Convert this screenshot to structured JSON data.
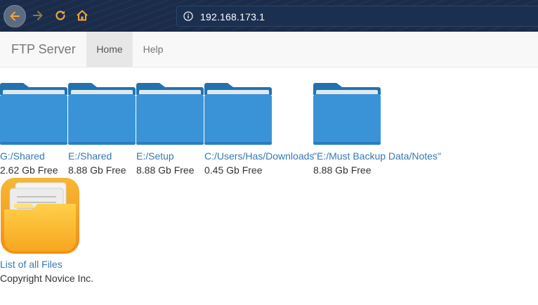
{
  "browser": {
    "url": "192.168.173.1",
    "icons": [
      "back-arrow-icon",
      "forward-arrow-icon",
      "reload-icon",
      "home-icon",
      "info-icon"
    ],
    "colors": {
      "toolbar": "#1a2c4a",
      "home_icon": "#f0a63a",
      "reload_icon": "#f0a63a"
    }
  },
  "navbar": {
    "brand": "FTP Server",
    "items": [
      {
        "label": "Home",
        "active": true
      },
      {
        "label": "Help",
        "active": false
      }
    ]
  },
  "drives": [
    {
      "path": "G:/Shared",
      "free": "2.62 Gb Free"
    },
    {
      "path": "E:/Shared",
      "free": "8.88 Gb Free"
    },
    {
      "path": "E:/Setup",
      "free": "8.88 Gb Free"
    },
    {
      "path": "C:/Users/Has/Downloads",
      "free": "0.45 Gb Free"
    },
    {
      "path": "\"E:/Must Backup Data/Notes\"",
      "free": "8.88 Gb Free"
    }
  ],
  "all_files": {
    "label": "List of all Files",
    "icon": "file-folder-icon"
  },
  "footer": {
    "copyright": "Copyright Novice Inc."
  },
  "colors": {
    "link": "#337ab7",
    "folder": "#3a93d6",
    "folder_dark": "#2273ad"
  }
}
